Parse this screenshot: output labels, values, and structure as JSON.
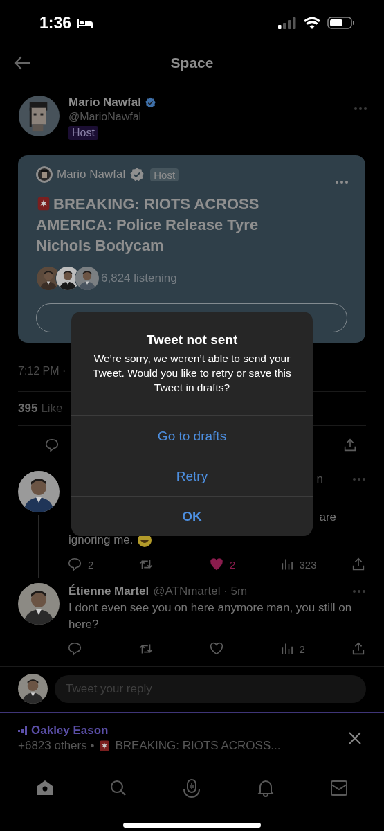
{
  "status_bar": {
    "time": "1:36"
  },
  "header": {
    "title": "Space"
  },
  "host": {
    "name": "Mario Nawfal",
    "handle": "@MarioNawfal",
    "badge": "Host",
    "verified": true
  },
  "space_card": {
    "host_name": "Mario Nawfal",
    "host_badge": "Host",
    "verified": true,
    "title": "BREAKING: RIOTS ACROSS AMERICA: Police Release Tyre Nichols Bodycam",
    "listeners": "6,824 listening"
  },
  "tweet_meta": {
    "time": "7:12 PM ·",
    "likes_count": "395",
    "likes_label": "Like"
  },
  "replies": [
    {
      "kind": "covered",
      "meta": "n",
      "text_end": "are",
      "text_tail": "ignoring me.",
      "replies": "2",
      "liked": true,
      "likes": "2",
      "views": "323",
      "thread": true
    },
    {
      "kind": "full",
      "name": "Étienne Martel",
      "meta": "@ATNmartel · 5m",
      "text": "I dont even see you on here anymore man, you still on here?",
      "liked": false,
      "views": "2",
      "thread": false
    }
  ],
  "reply_box": {
    "placeholder": "Tweet your reply"
  },
  "mini_player": {
    "speaker": "Oakley Eason",
    "others": "+6823 others •",
    "title": "BREAKING: RIOTS ACROSS..."
  },
  "tab_bar": [
    {
      "kind": "home",
      "selected": true
    },
    {
      "kind": "search",
      "selected": false
    },
    {
      "kind": "spaces",
      "selected": false
    },
    {
      "kind": "notifications",
      "selected": false
    },
    {
      "kind": "messages",
      "selected": false
    }
  ],
  "alert": {
    "title": "Tweet not sent",
    "message": "We’re sorry, we weren’t able to send your Tweet. Would you like to retry or save this Tweet in drafts?",
    "actions": [
      {
        "label": "Go to drafts",
        "kind": "default"
      },
      {
        "label": "Retry",
        "kind": "default"
      },
      {
        "label": "OK",
        "kind": "preferred"
      }
    ]
  }
}
